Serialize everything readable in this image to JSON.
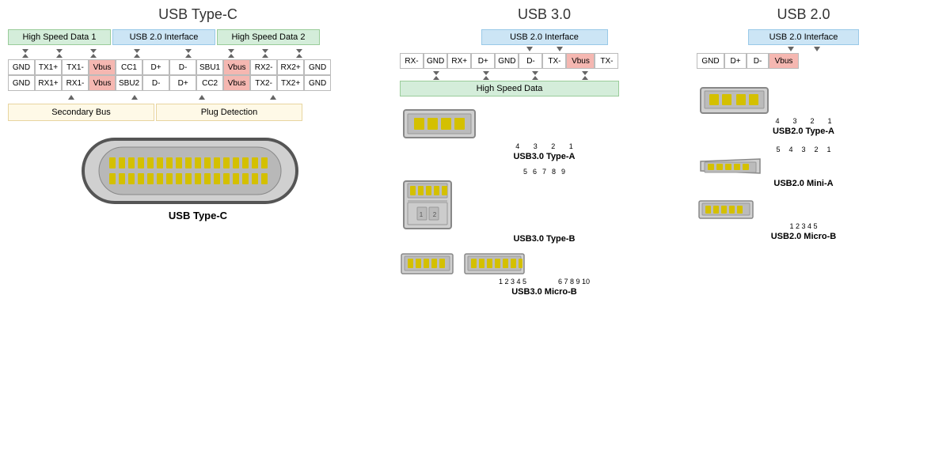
{
  "titles": {
    "typec": "USB Type-C",
    "usb30": "USB 3.0",
    "usb20": "USB 2.0"
  },
  "typec": {
    "top_labels": {
      "hs1": "High Speed Data 1",
      "usb2": "USB 2.0 Interface",
      "hs2": "High Speed Data 2"
    },
    "row1": [
      "GND",
      "TX1+",
      "TX1-",
      "Vbus",
      "CC1",
      "D+",
      "D-",
      "SBU1",
      "Vbus",
      "RX2-",
      "RX2+",
      "GND"
    ],
    "row2": [
      "GND",
      "RX1+",
      "RX1-",
      "Vbus",
      "SBU2",
      "D-",
      "D+",
      "CC2",
      "Vbus",
      "TX2-",
      "TX2+",
      "GND"
    ],
    "bottom_labels": {
      "secondary": "Secondary Bus",
      "plug": "Plug Detection"
    },
    "connector_label": "USB Type-C"
  },
  "usb30": {
    "top_label": "USB 2.0 Interface",
    "pins": [
      "RX-",
      "GND",
      "RX+",
      "D+",
      "GND",
      "D-",
      "TX-",
      "Vbus",
      "TX-"
    ],
    "bottom_label": "High Speed Data",
    "connectors": [
      {
        "label": "USB3.0 Type-A",
        "pins": "4321"
      },
      {
        "label": "USB3.0 Type-B",
        "pins": "56789 12"
      },
      {
        "label": "USB3.0 Micro-B",
        "pins": "12345 678910"
      }
    ]
  },
  "usb20": {
    "top_label": "USB 2.0 Interface",
    "pins": [
      "GND",
      "D+",
      "D-",
      "Vbus"
    ],
    "connectors": [
      {
        "label": "USB2.0 Type-A",
        "pins": "4321"
      },
      {
        "label": "USB2.0 Mini-A",
        "pins": "54321"
      },
      {
        "label": "USB2.0 Micro-B",
        "pins": "12345"
      }
    ]
  },
  "red_pins": [
    "Vbus"
  ],
  "green_pins": []
}
